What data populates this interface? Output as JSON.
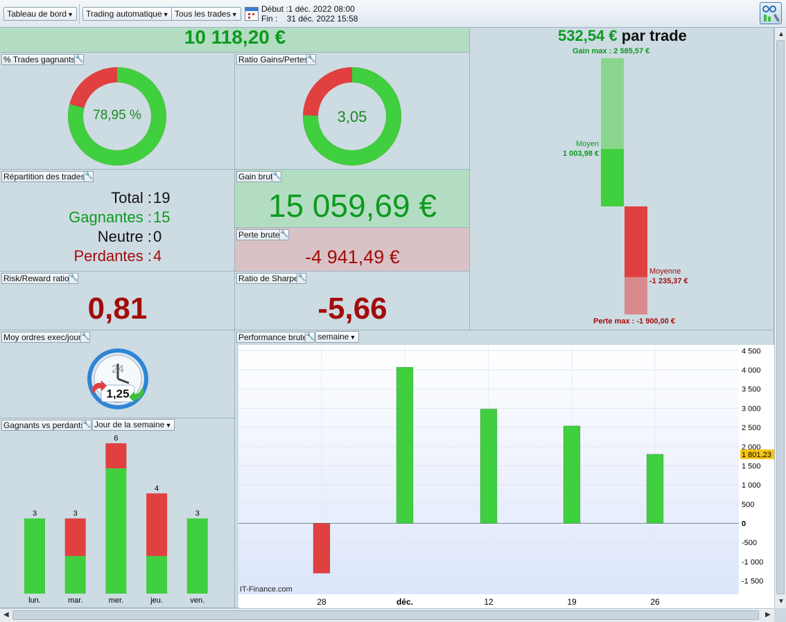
{
  "toolbar": {
    "dashboard_dropdown": "Tableau de bord",
    "trading_dropdown": "Trading automatique",
    "trades_filter_dropdown": "Tous les trades",
    "start_label": "Début :",
    "start_value": "1 déc. 2022 08:00",
    "end_label": "Fin :",
    "end_value": "31 déc. 2022 15:58"
  },
  "summary": {
    "total_gain": "10 118,20 €"
  },
  "win_rate": {
    "title": "% Trades gagnants",
    "value_label": "78,95 %",
    "percent": 78.95
  },
  "gain_loss_ratio": {
    "title": "Ratio Gains/Pertes",
    "value_label": "3,05",
    "percent": 75.3
  },
  "trade_split": {
    "title": "Répartition des trades",
    "total_label": "Total :",
    "total_value": "19",
    "win_label": "Gagnantes :",
    "win_value": "15",
    "neutral_label": "Neutre :",
    "neutral_value": "0",
    "loss_label": "Perdantes :",
    "loss_value": "4"
  },
  "gross_gain": {
    "title": "Gain brut",
    "value": "15 059,69 €"
  },
  "gross_loss": {
    "title": "Perte brute",
    "value": "-4 941,49 €"
  },
  "risk_reward": {
    "title": "Risk/Reward ratio",
    "value": "0,81"
  },
  "sharpe": {
    "title": "Ratio de Sharpe",
    "value": "-5,66"
  },
  "per_trade": {
    "value": "532,54 €",
    "suffix": "par trade",
    "gain_max_label": "Gain max : 2 585,57 €",
    "avg_gain_label": "Moyen",
    "avg_gain_value": "1 003,98 €",
    "avg_loss_label": "Moyenne",
    "avg_loss_value": "-1 235,37 €",
    "loss_max_label": "Perte max : -1 900,00 €"
  },
  "orders": {
    "title": "Moy ordres exec/jour",
    "value": "1,25",
    "clock_label": "24"
  },
  "winners_losers": {
    "title": "Gagnants vs perdants",
    "period_dropdown": "Jour de la semaine"
  },
  "performance": {
    "title": "Performance brute",
    "period_dropdown": "semaine",
    "watermark": "IT-Finance.com",
    "current_value": "1 801,23"
  },
  "colors": {
    "green": "#3fcf3f",
    "red": "#e04040",
    "dark_green": "#0c9a1f",
    "dark_red": "#a30b0b"
  },
  "chart_data": [
    {
      "type": "bar",
      "title": "Gagnants vs perdants",
      "categories": [
        "lun.",
        "mar.",
        "mer.",
        "jeu.",
        "ven."
      ],
      "series": [
        {
          "values": [
            3,
            1.5,
            5,
            1.5,
            3
          ]
        },
        {
          "values": [
            0,
            1.5,
            1,
            2.5,
            0
          ]
        }
      ],
      "totals": [
        "3",
        "3",
        "6",
        "4",
        "3"
      ],
      "ylim": [
        0,
        6
      ]
    },
    {
      "type": "bar",
      "title": "Performance brute",
      "categories": [
        "28",
        "déc.",
        "12",
        "19",
        "26"
      ],
      "values": [
        -1300,
        4070,
        2980,
        2540,
        1801.23
      ],
      "y_ticks": [
        "4 500",
        "4 000",
        "3 500",
        "3 000",
        "2 500",
        "2 000",
        "1 500",
        "1 000",
        "500",
        "0",
        "-500",
        "-1 000",
        "-1 500"
      ],
      "ylim": [
        -1850,
        4650
      ]
    }
  ]
}
